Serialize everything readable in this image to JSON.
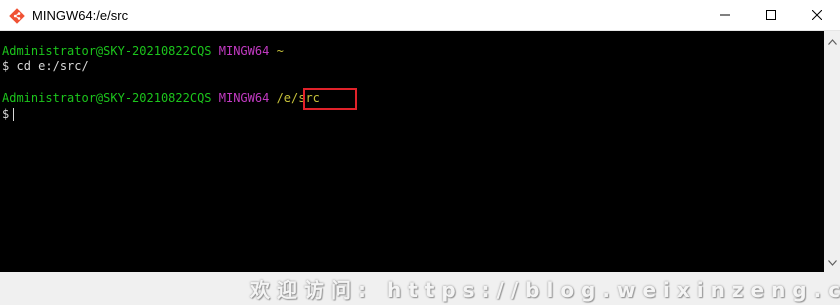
{
  "window": {
    "title": "MINGW64:/e/src"
  },
  "terminal": {
    "line1": {
      "user": "Administrator@SKY-20210822CQS",
      "env": "MINGW64",
      "path": "~"
    },
    "line2": {
      "prompt": "$",
      "command": "cd e:/src/"
    },
    "line3": {
      "user": "Administrator@SKY-20210822CQS",
      "env": "MINGW64",
      "path": "/e/src"
    },
    "line4": {
      "prompt": "$"
    }
  },
  "watermark": {
    "text": "欢迎访问: https://blog.weixinzeng.cn"
  },
  "colors": {
    "user_green": "#1cc51c",
    "env_magenta": "#c23ac2",
    "path_yellow": "#c7c23a",
    "highlight_red": "#e1222a"
  },
  "icons": {
    "app": "git-diamond-icon",
    "minimize": "minimize-icon",
    "maximize": "maximize-icon",
    "close": "close-icon"
  }
}
